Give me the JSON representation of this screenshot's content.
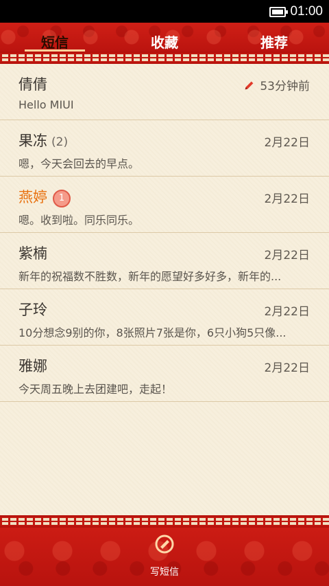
{
  "status_bar": {
    "time": "01:00",
    "battery_icon": "battery-icon"
  },
  "tabs": [
    {
      "label": "短信",
      "active": true
    },
    {
      "label": "收藏",
      "active": false
    },
    {
      "label": "推荐",
      "active": false
    }
  ],
  "messages": [
    {
      "name": "倩倩",
      "count": "",
      "badge": "",
      "time": "53分钟前",
      "draft": true,
      "snippet": "Hello MIUI"
    },
    {
      "name": "果冻",
      "count": "(2)",
      "badge": "",
      "time": "2月22日",
      "draft": false,
      "snippet": "嗯，今天会回去的早点。"
    },
    {
      "name": "燕婷",
      "count": "",
      "badge": "1",
      "time": "2月22日",
      "draft": false,
      "unread": true,
      "snippet": "嗯。收到啦。同乐同乐。"
    },
    {
      "name": "紫楠",
      "count": "",
      "badge": "",
      "time": "2月22日",
      "draft": false,
      "snippet": "新年的祝福数不胜数，新年的愿望好多好多，新年的..."
    },
    {
      "name": "子玲",
      "count": "",
      "badge": "",
      "time": "2月22日",
      "draft": false,
      "snippet": "10分想念9别的你，8张照片7张是你，6只小狗5只像..."
    },
    {
      "name": "雅娜",
      "count": "",
      "badge": "",
      "time": "2月22日",
      "draft": false,
      "snippet": "今天周五晚上去团建吧，走起！"
    }
  ],
  "bottom_bar": {
    "compose_label": "写短信",
    "compose_icon": "compose-icon"
  },
  "colors": {
    "header_red": "#c4180f",
    "unread_orange": "#e8710f",
    "list_bg": "#f7efdd",
    "active_tab_text": "#2a0c00"
  }
}
